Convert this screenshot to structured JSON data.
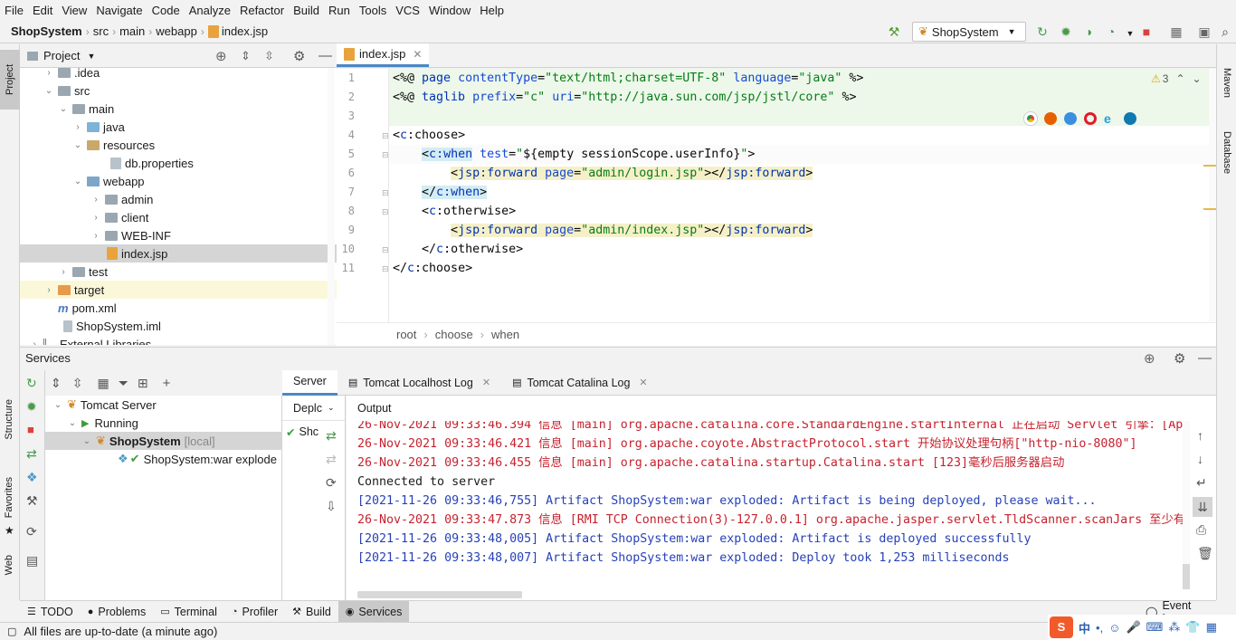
{
  "menu": [
    "File",
    "Edit",
    "View",
    "Navigate",
    "Code",
    "Analyze",
    "Refactor",
    "Build",
    "Run",
    "Tools",
    "VCS",
    "Window",
    "Help"
  ],
  "breadcrumb": {
    "project": "ShopSystem",
    "items": [
      "src",
      "main",
      "webapp",
      "index.jsp"
    ]
  },
  "run_config": "ShopSystem",
  "left_tabs": {
    "project": "Project",
    "structure": "Structure",
    "favorites": "Favorites",
    "web": "Web"
  },
  "right_tabs": {
    "maven": "Maven",
    "database": "Database"
  },
  "project_panel": {
    "title": "Project"
  },
  "tree": [
    {
      "label": ".idea",
      "indent": 1,
      "type": "folder"
    },
    {
      "label": "src",
      "indent": 1,
      "type": "folder"
    },
    {
      "label": "main",
      "indent": 2,
      "type": "folder"
    },
    {
      "label": "java",
      "indent": 3,
      "type": "src"
    },
    {
      "label": "resources",
      "indent": 3,
      "type": "res"
    },
    {
      "label": "db.properties",
      "indent": 4,
      "type": "file"
    },
    {
      "label": "webapp",
      "indent": 3,
      "type": "web"
    },
    {
      "label": "admin",
      "indent": 4,
      "type": "folder"
    },
    {
      "label": "client",
      "indent": 4,
      "type": "folder"
    },
    {
      "label": "WEB-INF",
      "indent": 4,
      "type": "folder"
    },
    {
      "label": "index.jsp",
      "indent": 5,
      "type": "jsp"
    },
    {
      "label": "test",
      "indent": 2,
      "type": "folder"
    },
    {
      "label": "target",
      "indent": 1,
      "type": "target"
    },
    {
      "label": "pom.xml",
      "indent": 1,
      "type": "maven"
    },
    {
      "label": "ShopSystem.iml",
      "indent": 1,
      "type": "file"
    },
    {
      "label": "External Libraries",
      "indent": 0,
      "type": "lib"
    }
  ],
  "editor": {
    "tab": "index.jsp",
    "warnings": "3",
    "lines": [
      "1",
      "2",
      "3",
      "4",
      "5",
      "6",
      "7",
      "8",
      "9",
      "10",
      "11"
    ],
    "breadcrumbs": [
      "root",
      "choose",
      "when"
    ]
  },
  "services": {
    "title": "Services",
    "tree": {
      "server": "Tomcat Server",
      "running": "Running",
      "system": "ShopSystem",
      "local": "[local]",
      "artifact": "ShopSystem:war explode"
    },
    "tabs": {
      "server": "Server",
      "localhost_log": "Tomcat Localhost Log",
      "catalina_log": "Tomcat Catalina Log"
    },
    "deploy_hdr": "Deplc",
    "deploy_item": "Shc",
    "output_hdr": "Output",
    "console": [
      {
        "text": "26-Nov-2021 09:33:46.394 信息 [main] org.apache.catalina.core.StandardEngine.startInternal 正在启动 Servlet 引擎：[Apac",
        "c": "red"
      },
      {
        "text": "26-Nov-2021 09:33:46.421 信息 [main] org.apache.coyote.AbstractProtocol.start 开始协议处理句柄[\"http-nio-8080\"]",
        "c": "red"
      },
      {
        "text": "26-Nov-2021 09:33:46.455 信息 [main] org.apache.catalina.startup.Catalina.start [123]毫秒后服务器启动",
        "c": "red"
      },
      {
        "text": "Connected to server",
        "c": "blk"
      },
      {
        "text": "[2021-11-26 09:33:46,755] Artifact ShopSystem:war exploded: Artifact is being deployed, please wait...",
        "c": "blue"
      },
      {
        "text": "26-Nov-2021 09:33:47.873 信息 [RMI TCP Connection(3)-127.0.0.1] org.apache.jasper.servlet.TldScanner.scanJars 至少有一",
        "c": "red"
      },
      {
        "text": "[2021-11-26 09:33:48,005] Artifact ShopSystem:war exploded: Artifact is deployed successfully",
        "c": "blue"
      },
      {
        "text": "[2021-11-26 09:33:48,007] Artifact ShopSystem:war exploded: Deploy took 1,253 milliseconds",
        "c": "blue"
      }
    ]
  },
  "bottom_tabs": [
    "TODO",
    "Problems",
    "Terminal",
    "Profiler",
    "Build",
    "Services"
  ],
  "event_log": "Event Log",
  "status": "All files are up-to-date (a minute ago)",
  "ime": {
    "logo": "S",
    "lang": "中"
  }
}
